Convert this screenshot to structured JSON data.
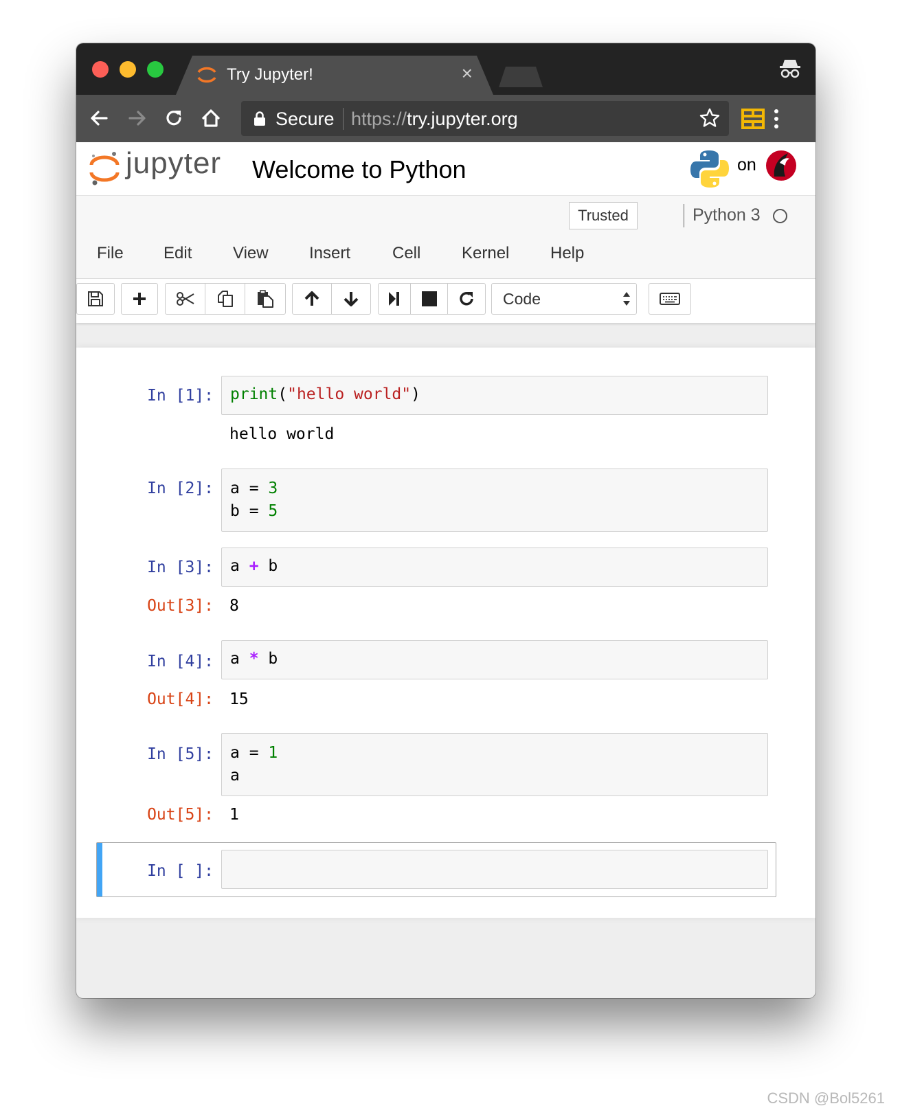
{
  "browser": {
    "tab_title": "Try Jupyter!",
    "tab_close": "×",
    "secure_label": "Secure",
    "url_scheme": "https",
    "url_separator": "://",
    "url_host": "try.jupyter.org"
  },
  "jupyter": {
    "logo_text": "jupyter",
    "notebook_title": "Welcome to Python",
    "on_label": "on",
    "trusted_label": "Trusted",
    "kernel_name": "Python 3",
    "menu": [
      "File",
      "Edit",
      "View",
      "Insert",
      "Cell",
      "Kernel",
      "Help"
    ],
    "cell_type": "Code"
  },
  "cells": [
    {
      "prompt": "In [1]:",
      "output": "hello world"
    },
    {
      "prompt": "In [2]:"
    },
    {
      "prompt": "In [3]:",
      "out_prompt": "Out[3]:",
      "output": "8"
    },
    {
      "prompt": "In [4]:",
      "out_prompt": "Out[4]:",
      "output": "15"
    },
    {
      "prompt": "In [5]:",
      "out_prompt": "Out[5]:",
      "output": "1"
    },
    {
      "prompt": "In [ ]:"
    }
  ],
  "code": {
    "c1_fn": "print",
    "c1_open": "(",
    "c1_str": "\"hello world\"",
    "c1_close": ")",
    "c2_l1_a": "a = ",
    "c2_l1_b": "3",
    "c2_l2_a": "b = ",
    "c2_l2_b": "5",
    "c3_a": "a ",
    "c3_op": "+",
    "c3_b": " b",
    "c4_a": "a ",
    "c4_op": "*",
    "c4_b": " b",
    "c5_l1_a": "a = ",
    "c5_l1_b": "1",
    "c5_l2": "a"
  },
  "colors": {
    "accent_selected": "#42a5f5",
    "in_prompt": "#303f9f",
    "out_prompt": "#d84315"
  },
  "watermark": "CSDN @Bol5261"
}
